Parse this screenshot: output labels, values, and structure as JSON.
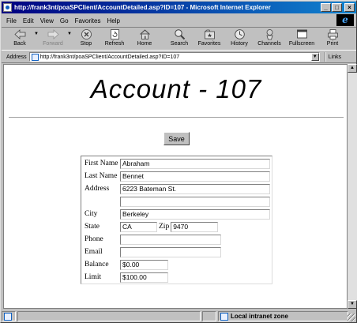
{
  "window": {
    "title": "http://frank3nt/poaSPClient/AccountDetailed.asp?ID=107 - Microsoft Internet Explorer",
    "controls": {
      "minimize": "_",
      "maximize": "□",
      "close": "×"
    }
  },
  "menu": [
    "File",
    "Edit",
    "View",
    "Go",
    "Favorites",
    "Help"
  ],
  "toolbar": [
    {
      "label": "Back",
      "icon": "back-arrow-icon",
      "enabled": true,
      "dropdown": true
    },
    {
      "label": "Forward",
      "icon": "forward-arrow-icon",
      "enabled": false,
      "dropdown": true
    },
    {
      "label": "Stop",
      "icon": "stop-icon",
      "enabled": true
    },
    {
      "label": "Refresh",
      "icon": "refresh-icon",
      "enabled": true
    },
    {
      "label": "Home",
      "icon": "home-icon",
      "enabled": true
    },
    {
      "label": "Search",
      "icon": "search-icon",
      "enabled": true
    },
    {
      "label": "Favorites",
      "icon": "favorites-icon",
      "enabled": true
    },
    {
      "label": "History",
      "icon": "history-icon",
      "enabled": true
    },
    {
      "label": "Channels",
      "icon": "channels-icon",
      "enabled": true
    },
    {
      "label": "Fullscreen",
      "icon": "fullscreen-icon",
      "enabled": true
    },
    {
      "label": "Print",
      "icon": "print-icon",
      "enabled": true
    }
  ],
  "address": {
    "label": "Address",
    "url": "http://frank3nt/poaSPClient/AccountDetailed.asp?ID=107",
    "links_label": "Links"
  },
  "page": {
    "title": "Account - 107",
    "save_label": "Save",
    "labels": {
      "first_name": "First Name",
      "last_name": "Last Name",
      "address": "Address",
      "city": "City",
      "state": "State",
      "zip": "Zip",
      "phone": "Phone",
      "email": "Email",
      "balance": "Balance",
      "limit": "Limit"
    },
    "values": {
      "first_name": "Abraham",
      "last_name": "Bennet",
      "address1": "6223 Bateman St.",
      "address2": "",
      "city": "Berkeley",
      "state": "CA",
      "zip": "9470",
      "phone": "",
      "email": "",
      "balance": "$0.00",
      "limit": "$100.00"
    }
  },
  "status": {
    "zone": "Local intranet zone"
  },
  "colors": {
    "titlebar_start": "#000080",
    "titlebar_end": "#1084d0",
    "chrome": "#c0c0c0"
  }
}
